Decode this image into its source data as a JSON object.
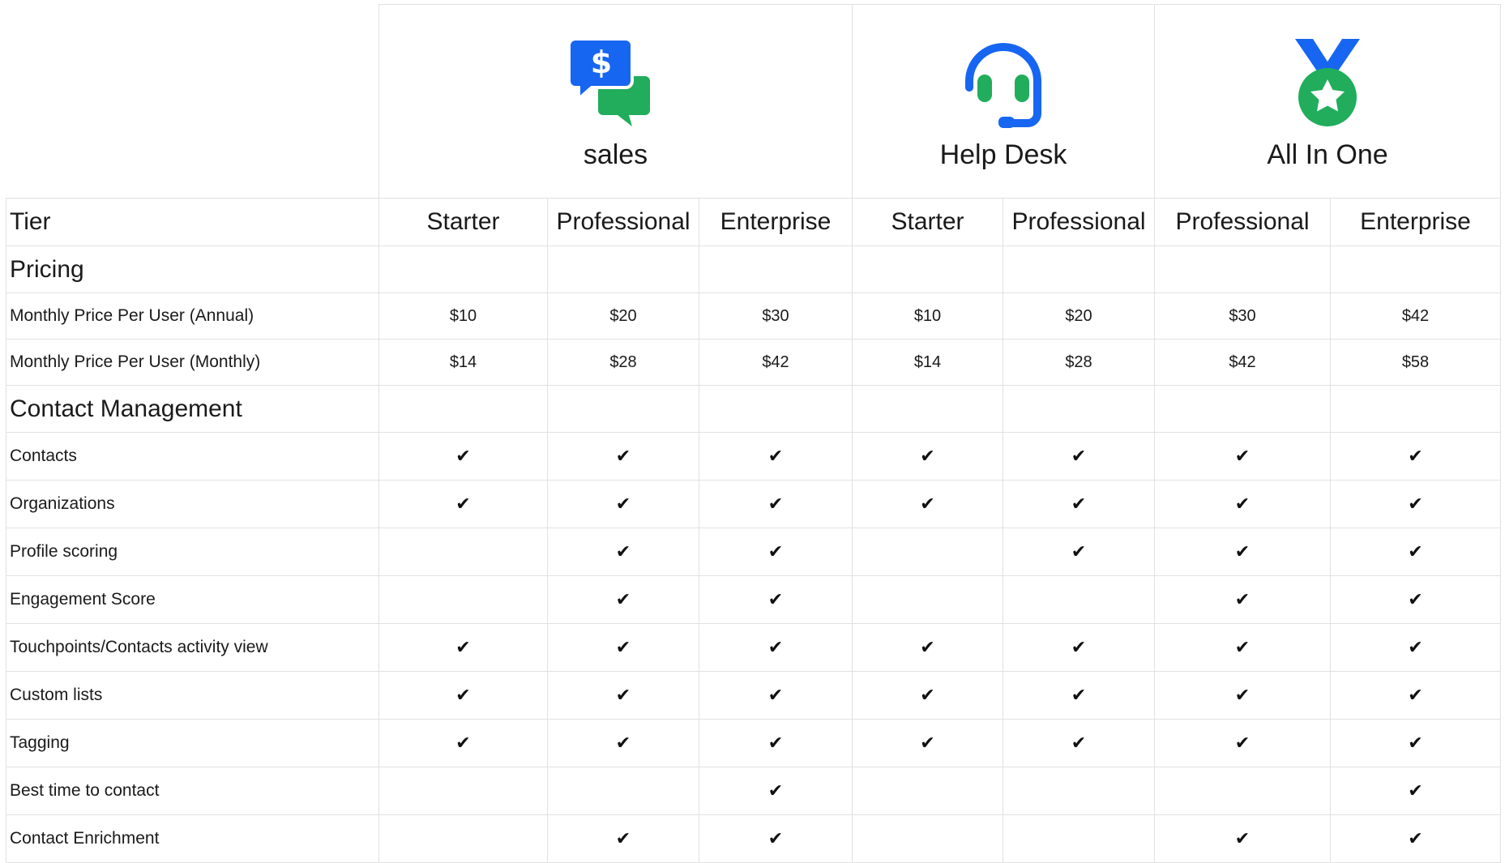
{
  "products": [
    {
      "name": "sales",
      "icon": "sales-chat-dollar-icon"
    },
    {
      "name": "Help Desk",
      "icon": "headset-icon"
    },
    {
      "name": "All In One",
      "icon": "medal-star-icon"
    }
  ],
  "colors": {
    "blue": "#1766f2",
    "green": "#21ad5b",
    "grid": "#e1e1e1"
  },
  "check_glyph": "✔",
  "tier_label": "Tier",
  "tiers": [
    "Starter",
    "Professional",
    "Enterprise",
    "Starter",
    "Professional",
    "Professional",
    "Enterprise"
  ],
  "sections": {
    "pricing": "Pricing",
    "contact_management": "Contact Management"
  },
  "pricing_rows": [
    {
      "label": "Monthly Price Per User (Annual)",
      "values": [
        "$10",
        "$20",
        "$30",
        "$10",
        "$20",
        "$30",
        "$42"
      ]
    },
    {
      "label": "Monthly Price Per User (Monthly)",
      "values": [
        "$14",
        "$28",
        "$42",
        "$14",
        "$28",
        "$42",
        "$58"
      ]
    }
  ],
  "feature_rows": [
    {
      "label": "Contacts",
      "checks": [
        true,
        true,
        true,
        true,
        true,
        true,
        true
      ]
    },
    {
      "label": "Organizations",
      "checks": [
        true,
        true,
        true,
        true,
        true,
        true,
        true
      ]
    },
    {
      "label": "Profile scoring",
      "checks": [
        false,
        true,
        true,
        false,
        true,
        true,
        true
      ]
    },
    {
      "label": "Engagement Score",
      "checks": [
        false,
        true,
        true,
        false,
        false,
        true,
        true
      ]
    },
    {
      "label": "Touchpoints/Contacts activity view",
      "checks": [
        true,
        true,
        true,
        true,
        true,
        true,
        true
      ]
    },
    {
      "label": "Custom lists",
      "checks": [
        true,
        true,
        true,
        true,
        true,
        true,
        true
      ]
    },
    {
      "label": "Tagging",
      "checks": [
        true,
        true,
        true,
        true,
        true,
        true,
        true
      ]
    },
    {
      "label": "Best time to contact",
      "checks": [
        false,
        false,
        true,
        false,
        false,
        false,
        true
      ]
    },
    {
      "label": "Contact Enrichment",
      "checks": [
        false,
        true,
        true,
        false,
        false,
        true,
        true
      ]
    }
  ]
}
